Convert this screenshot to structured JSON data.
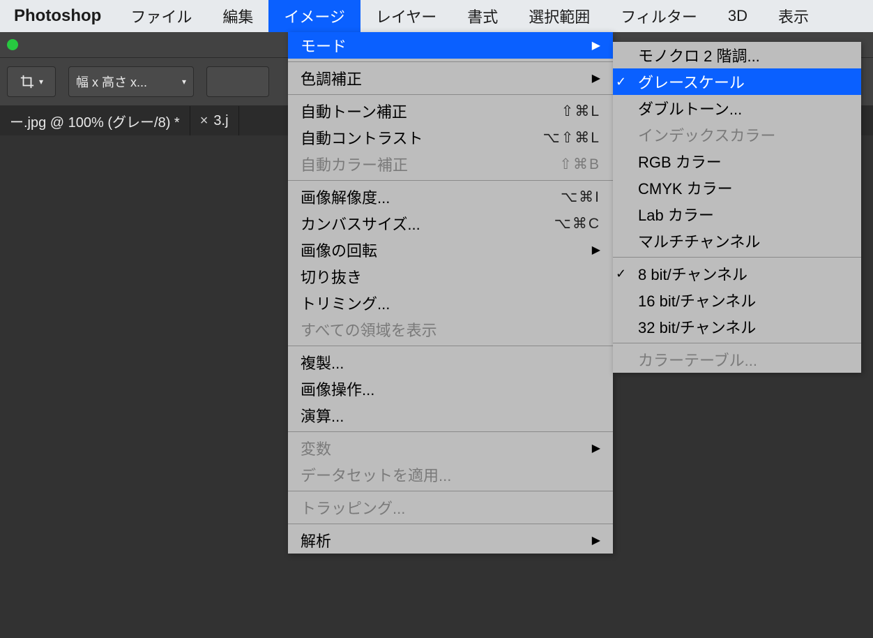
{
  "menubar": {
    "app": "Photoshop",
    "items": [
      "ファイル",
      "編集",
      "イメージ",
      "レイヤー",
      "書式",
      "選択範囲",
      "フィルター",
      "3D",
      "表示"
    ],
    "activeIndex": 2
  },
  "toolbar": {
    "presetLabel": "幅 x 高さ x..."
  },
  "tabs": [
    {
      "label": "ー.jpg @ 100% (グレー/8) *",
      "closable": false
    },
    {
      "label": "3.j",
      "closable": true
    }
  ],
  "imageMenu": [
    {
      "label": "モード",
      "submenu": true,
      "highlight": true
    },
    {
      "sep": true
    },
    {
      "label": "色調補正",
      "submenu": true
    },
    {
      "sep": true
    },
    {
      "label": "自動トーン補正",
      "shortcut": "⇧⌘L"
    },
    {
      "label": "自動コントラスト",
      "shortcut": "⌥⇧⌘L"
    },
    {
      "label": "自動カラー補正",
      "shortcut": "⇧⌘B",
      "disabled": true
    },
    {
      "sep": true
    },
    {
      "label": "画像解像度...",
      "shortcut": "⌥⌘I"
    },
    {
      "label": "カンバスサイズ...",
      "shortcut": "⌥⌘C"
    },
    {
      "label": "画像の回転",
      "submenu": true
    },
    {
      "label": "切り抜き"
    },
    {
      "label": "トリミング..."
    },
    {
      "label": "すべての領域を表示",
      "disabled": true
    },
    {
      "sep": true
    },
    {
      "label": "複製..."
    },
    {
      "label": "画像操作..."
    },
    {
      "label": "演算..."
    },
    {
      "sep": true
    },
    {
      "label": "変数",
      "submenu": true,
      "disabled": true
    },
    {
      "label": "データセットを適用...",
      "disabled": true
    },
    {
      "sep": true
    },
    {
      "label": "トラッピング...",
      "disabled": true
    },
    {
      "sep": true
    },
    {
      "label": "解析",
      "submenu": true
    }
  ],
  "modeMenu": [
    {
      "label": "モノクロ 2 階調..."
    },
    {
      "label": "グレースケール",
      "checked": true,
      "highlight": true
    },
    {
      "label": "ダブルトーン..."
    },
    {
      "label": "インデックスカラー",
      "disabled": true
    },
    {
      "label": "RGB カラー"
    },
    {
      "label": "CMYK カラー"
    },
    {
      "label": "Lab カラー"
    },
    {
      "label": "マルチチャンネル"
    },
    {
      "sep": true
    },
    {
      "label": "8 bit/チャンネル",
      "checked": true
    },
    {
      "label": "16 bit/チャンネル"
    },
    {
      "label": "32 bit/チャンネル"
    },
    {
      "sep": true
    },
    {
      "label": "カラーテーブル...",
      "disabled": true
    }
  ]
}
